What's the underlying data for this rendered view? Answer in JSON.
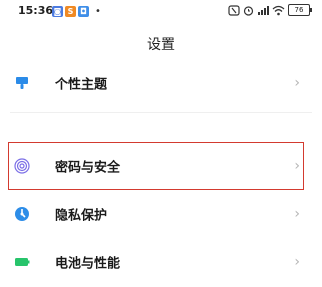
{
  "status_bar": {
    "time": "15:36",
    "notifications": [
      {
        "icon": "app-badge-icon",
        "color": "#4c7be0",
        "glyph": "◙"
      },
      {
        "icon": "app-badge-icon",
        "color": "#f08a24",
        "glyph": "S"
      },
      {
        "icon": "app-badge-icon",
        "color": "#3f8ee8",
        "glyph": "◘"
      }
    ],
    "dot": "•",
    "battery": "76"
  },
  "page": {
    "title": "设置"
  },
  "rows": [
    {
      "label": "个性主题",
      "icon": "theme-icon",
      "color": "#2b8be8"
    },
    {
      "label": "密码与安全",
      "icon": "fingerprint-icon",
      "color": "#7b6fe6"
    },
    {
      "label": "隐私保护",
      "icon": "privacy-icon",
      "color": "#2d8de8"
    },
    {
      "label": "电池与性能",
      "icon": "battery-icon",
      "color": "#27c46b"
    }
  ],
  "chevron": "›",
  "highlight_color": "#d33a2f"
}
